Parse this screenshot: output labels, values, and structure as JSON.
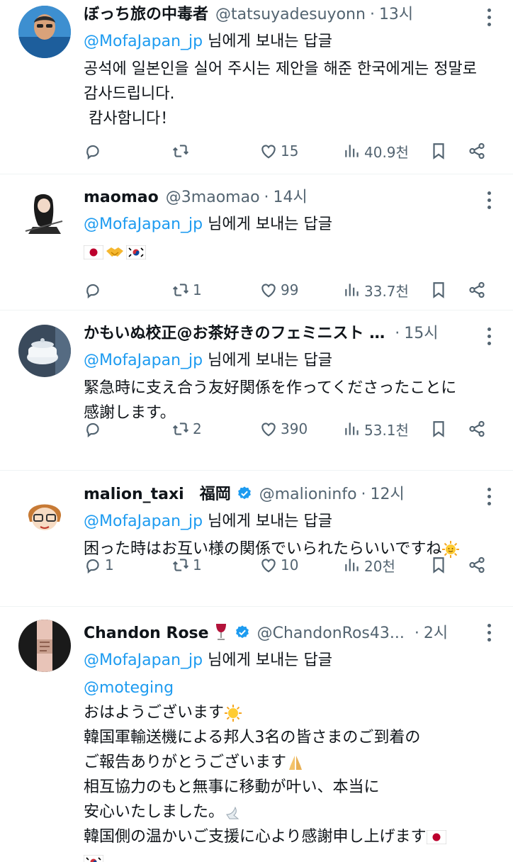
{
  "tweets": [
    {
      "name": "ぼっち旅の中毒者",
      "handle": "@tatsuyadesuyonn",
      "time": "13시",
      "reply_to_handle": "@MofaJapan_jp",
      "reply_to_suffix": "님에게 보내는 답글",
      "lines": [
        "공석에 일본인을 실어 주시는 제안을 해준 한국에게는 정말로",
        "감사드립니다.",
        " 캄사함니다！"
      ],
      "replies": "",
      "retweets": "",
      "likes": "15",
      "views": "40.9천"
    },
    {
      "name": "maomao",
      "handle": "@3maomao",
      "time": "14시",
      "reply_to_handle": "@MofaJapan_jp",
      "reply_to_suffix": "님에게 보내는 답글",
      "lines": [],
      "emoji_line": [
        "japan-flag",
        "handshake",
        "korea-flag"
      ],
      "replies": "",
      "retweets": "1",
      "likes": "99",
      "views": "33.7천"
    },
    {
      "name": "かもいぬ校正@お茶好きのフェミニスト …",
      "handle": "",
      "time": "15시",
      "reply_to_handle": "@MofaJapan_jp",
      "reply_to_suffix": "님에게 보내는 답글",
      "lines": [
        "緊急時に支え合う友好関係を作ってくださったことに",
        "感謝します。"
      ],
      "replies": "",
      "retweets": "2",
      "likes": "390",
      "views": "53.1천"
    },
    {
      "name": "malion_taxi　福岡",
      "handle": "@malioninfo",
      "time": "12시",
      "verified": true,
      "reply_to_handle": "@MofaJapan_jp",
      "reply_to_suffix": "님에게 보내는 답글",
      "lines": [
        "困った時はお互い様の関係でいられたらいいですね"
      ],
      "replies": "1",
      "retweets": "1",
      "likes": "10",
      "views": "20천"
    },
    {
      "name": "Chandon Rose",
      "handle": "@ChandonRos43...",
      "time": "2시",
      "verified": true,
      "reply_to_handle": "@MofaJapan_jp",
      "reply_to_suffix": "님에게 보내는 답글",
      "mention": "@moteging",
      "lines": [
        "おはようございます",
        "韓国軍輸送機による邦人3名の皆さまのご到着の",
        "ご報告ありがとうございます",
        "相互協力のもと無事に移動が叶い、本当に",
        "安心いたしました。",
        "韓国側の温かいご支援に心より感謝申し上げます"
      ],
      "replies": "",
      "retweets": "",
      "likes": "",
      "views": ""
    }
  ],
  "colors": {
    "accent": "#1d9bf0",
    "muted": "#536471",
    "text": "#0f1419",
    "divider": "#eff3f4"
  },
  "icons": [
    "reply-icon",
    "retweet-icon",
    "like-icon",
    "views-icon",
    "bookmark-icon",
    "share-icon",
    "more-icon",
    "verified-icon"
  ]
}
